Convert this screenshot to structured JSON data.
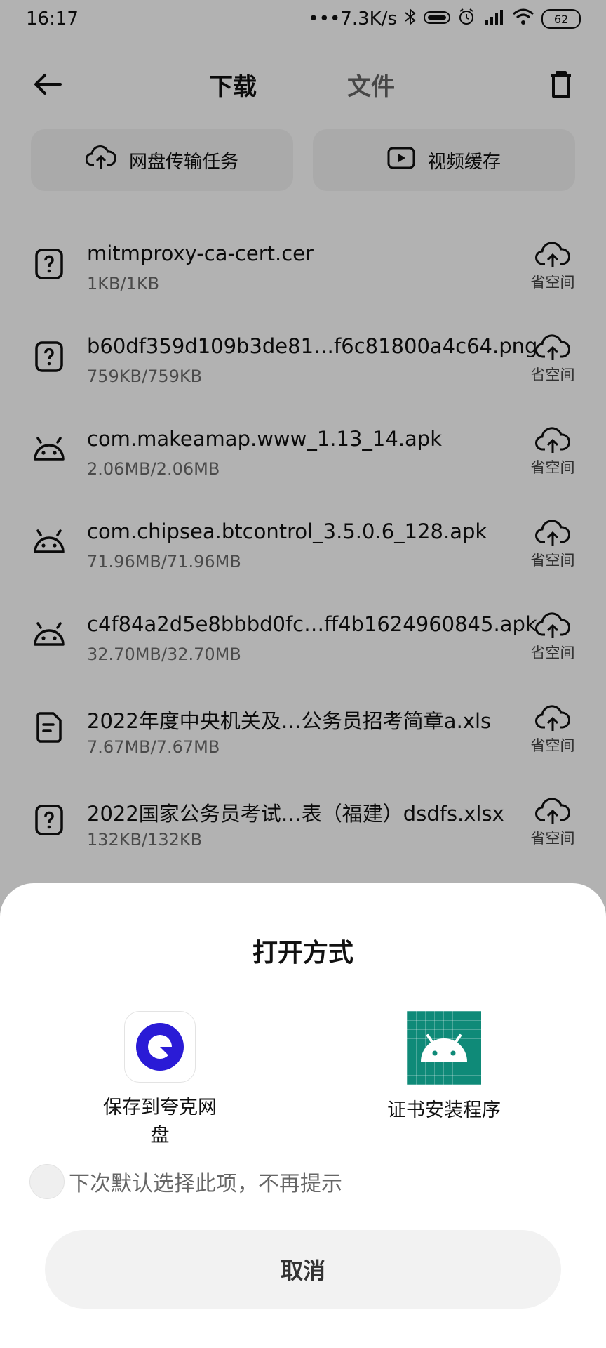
{
  "status_bar": {
    "time": "16:17",
    "net_speed": "7.3K/s",
    "battery": "62"
  },
  "header": {
    "tab_download": "下载",
    "tab_files": "文件"
  },
  "quick_actions": {
    "left": "网盘传输任务",
    "right": "视频缓存"
  },
  "files": [
    {
      "name": "mitmproxy-ca-cert.cer",
      "size": "1KB/1KB",
      "icon": "unknown-file-icon",
      "action": "省空间"
    },
    {
      "name": "b60df359d109b3de81…f6c81800a4c64.png",
      "size": "759KB/759KB",
      "icon": "unknown-file-icon",
      "action": "省空间"
    },
    {
      "name": "com.makeamap.www_1.13_14.apk",
      "size": "2.06MB/2.06MB",
      "icon": "android-icon",
      "action": "省空间"
    },
    {
      "name": "com.chipsea.btcontrol_3.5.0.6_128.apk",
      "size": "71.96MB/71.96MB",
      "icon": "android-icon",
      "action": "省空间"
    },
    {
      "name": "c4f84a2d5e8bbbd0fc…ff4b1624960845.apk",
      "size": "32.70MB/32.70MB",
      "icon": "android-icon",
      "action": "省空间"
    },
    {
      "name": "2022年度中央机关及…公务员招考简章a.xls",
      "size": "7.67MB/7.67MB",
      "icon": "document-icon",
      "action": "省空间"
    },
    {
      "name": "2022国家公务员考试…表（福建）dsdfs.xlsx",
      "size": "132KB/132KB",
      "icon": "unknown-file-icon",
      "action": "省空间"
    }
  ],
  "sheet": {
    "title": "打开方式",
    "apps": [
      {
        "label_line1": "保存到夸克网",
        "label_line2": "盘",
        "icon": "quark-icon"
      },
      {
        "label_line1": "证书安装程序",
        "label_line2": "",
        "icon": "android-cert-icon"
      }
    ],
    "remember_text": "下次默认选择此项，不再提示",
    "cancel": "取消"
  },
  "colors": {
    "accent_quark": "#2a1bd6",
    "cert_bg": "#0f8a78"
  }
}
